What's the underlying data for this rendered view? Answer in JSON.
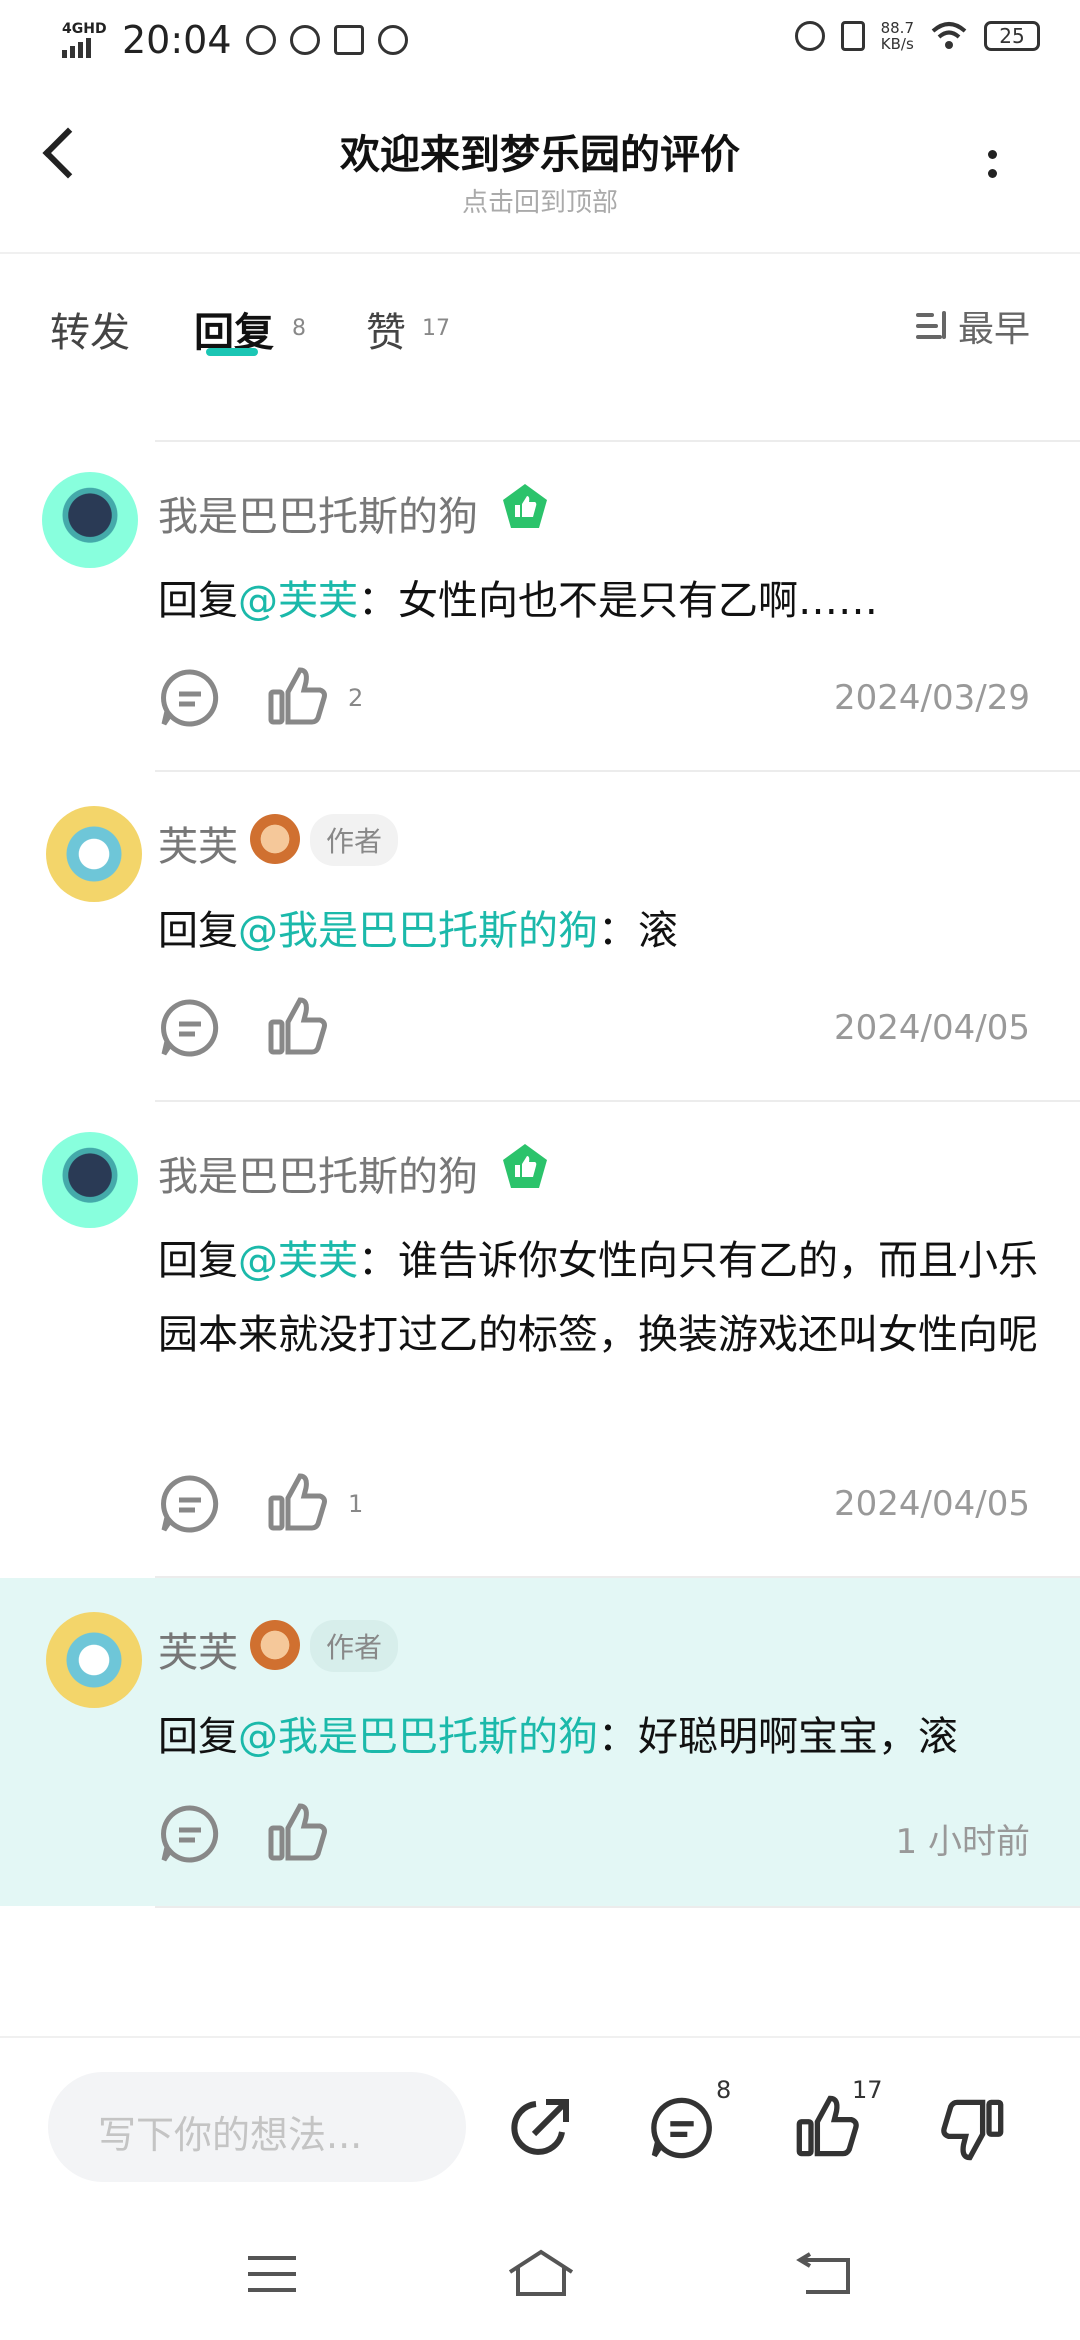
{
  "status": {
    "network": "4GHD",
    "time": "20:04",
    "speed_value": "88.7",
    "speed_unit": "KB/s",
    "battery": "25"
  },
  "header": {
    "title": "欢迎来到梦乐园的评价",
    "subtitle": "点击回到顶部"
  },
  "tabs": [
    {
      "label": "转发"
    },
    {
      "label": "回复",
      "count": "8"
    },
    {
      "label": "赞",
      "count": "17"
    }
  ],
  "sort": {
    "label": "最早"
  },
  "comments": [
    {
      "name": "我是巴巴托斯的狗",
      "reply_prefix": "回复",
      "mention": "@芙芙",
      "text": "：女性向也不是只有乙啊……",
      "likes": "2",
      "date": "2024/03/29"
    },
    {
      "name": "芙芙",
      "author_tag": "作者",
      "reply_prefix": "回复",
      "mention": "@我是巴巴托斯的狗",
      "text": "：滚",
      "likes": "",
      "date": "2024/04/05"
    },
    {
      "name": "我是巴巴托斯的狗",
      "reply_prefix": "回复",
      "mention": "@芙芙",
      "text": "：谁告诉你女性向只有乙的，而且小乐园本来就没打过乙的标签，换装游戏还叫女性向呢",
      "likes": "1",
      "date": "2024/04/05"
    },
    {
      "name": "芙芙",
      "author_tag": "作者",
      "reply_prefix": "回复",
      "mention": "@我是巴巴托斯的狗",
      "text": "：好聪明啊宝宝，滚",
      "likes": "",
      "date": "1 小时前"
    }
  ],
  "bottom": {
    "placeholder": "写下你的想法...",
    "comment_count": "8",
    "like_count": "17"
  },
  "colors": {
    "accent": "#1bc6b4",
    "mention": "#1bb9aa",
    "highlight_bg": "#e3f7f5"
  }
}
